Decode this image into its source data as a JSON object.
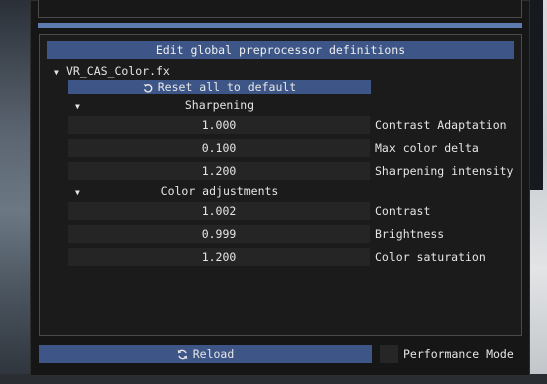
{
  "header": {
    "title": "Edit global preprocessor definitions"
  },
  "tree": {
    "file_name": "VR_CAS_Color.fx",
    "reset_label": "Reset all to default",
    "sections": [
      {
        "name": "Sharpening",
        "params": [
          {
            "value": "1.000",
            "label": "Contrast Adaptation"
          },
          {
            "value": "0.100",
            "label": "Max color delta"
          },
          {
            "value": "1.200",
            "label": "Sharpening intensity"
          }
        ]
      },
      {
        "name": "Color adjustments",
        "params": [
          {
            "value": "1.002",
            "label": "Contrast"
          },
          {
            "value": "0.999",
            "label": "Brightness"
          },
          {
            "value": "1.200",
            "label": "Color saturation"
          }
        ]
      }
    ]
  },
  "footer": {
    "reload_label": "Reload",
    "performance_mode_label": "Performance Mode",
    "performance_mode_checked": false
  },
  "colors": {
    "accent": "#3d5687",
    "panel_bg": "#1b1b1b",
    "field_bg": "#252525"
  },
  "icons": {
    "reset": "undo-arrow-icon",
    "reload": "refresh-icon",
    "expand": "triangle-down-icon"
  }
}
